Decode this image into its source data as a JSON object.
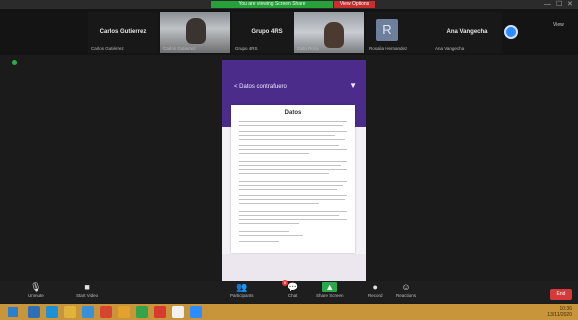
{
  "window": {
    "share_banner": "You are viewing Screen Share",
    "view_options": "View Options"
  },
  "gallery": {
    "participants": [
      {
        "name": "Carlos Gutierrez",
        "sub": "Carlos Gutiérrez"
      },
      {
        "name": "",
        "sub": "Carlos Gutierrez"
      },
      {
        "name": "Grupo 4RS",
        "sub": "Grupo 4RS"
      },
      {
        "name": "",
        "sub": "Zoila Roca"
      },
      {
        "name": "",
        "sub": "Rosalia Hernandez"
      },
      {
        "name": "Ana Vangecha",
        "sub": "Ana Vangecha"
      }
    ],
    "avatar_letter": "R",
    "view_label": "View"
  },
  "share": {
    "title": "< Datos contrafuero",
    "document_heading": "Datos"
  },
  "toolbar": {
    "unmute": "Unmute",
    "start_video": "Start Video",
    "participants": "Participants",
    "participants_count": "8",
    "chat": "Chat",
    "share_screen": "Share Screen",
    "record": "Record",
    "reactions": "Reactions",
    "end": "End"
  },
  "taskbar": {
    "time": "10:36",
    "date": "13/11/2020"
  },
  "colors": {
    "accent_purple": "#4b2c8a",
    "share_green": "#2aa84a",
    "end_red": "#d43a3a",
    "taskbar": "#c9953b"
  }
}
